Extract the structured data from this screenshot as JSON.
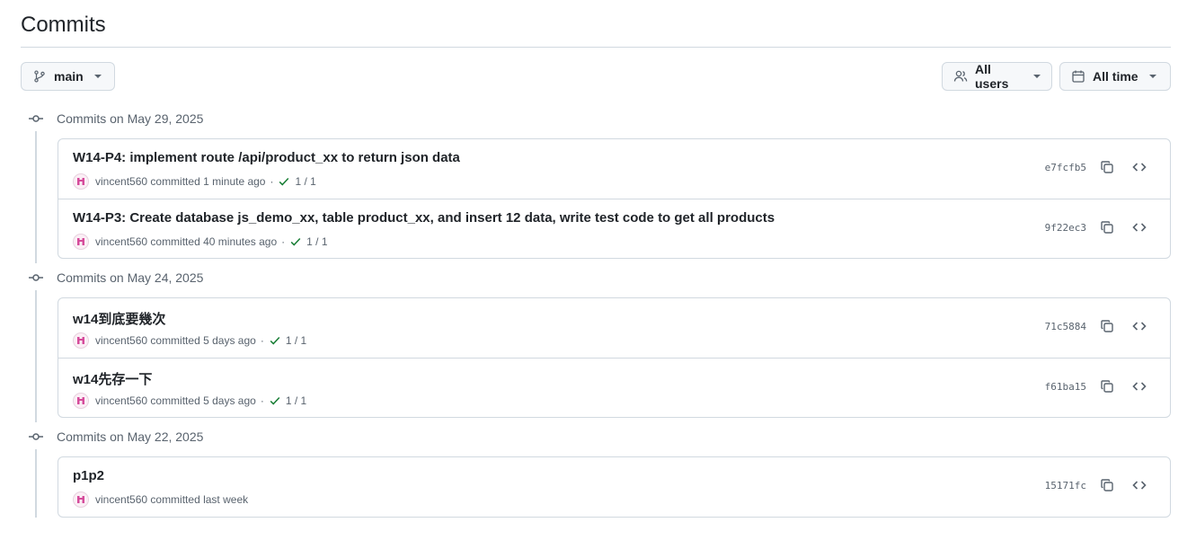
{
  "page": {
    "title": "Commits"
  },
  "filters": {
    "branch_label": "main",
    "users_label": "All users",
    "time_label": "All time"
  },
  "groups": [
    {
      "date": "Commits on May 29, 2025",
      "commits": [
        {
          "message": "W14-P4: implement route /api/product_xx to return json data",
          "author": "vincent560",
          "action": "committed",
          "time": "1 minute ago",
          "checks": "1 / 1",
          "sha": "e7fcfb5"
        },
        {
          "message": "W14-P3: Create database js_demo_xx, table product_xx, and insert 12 data, write test code to get all products",
          "author": "vincent560",
          "action": "committed",
          "time": "40 minutes ago",
          "checks": "1 / 1",
          "sha": "9f22ec3"
        }
      ]
    },
    {
      "date": "Commits on May 24, 2025",
      "commits": [
        {
          "message": "w14到底要幾次",
          "author": "vincent560",
          "action": "committed",
          "time": "5 days ago",
          "checks": "1 / 1",
          "sha": "71c5884"
        },
        {
          "message": "w14先存一下",
          "author": "vincent560",
          "action": "committed",
          "time": "5 days ago",
          "checks": "1 / 1",
          "sha": "f61ba15"
        }
      ]
    },
    {
      "date": "Commits on May 22, 2025",
      "commits": [
        {
          "message": "p1p2",
          "author": "vincent560",
          "action": "committed",
          "time": "last week",
          "sha": "15171fc"
        }
      ]
    }
  ],
  "colors": {
    "success": "#1a7f37",
    "muted": "#59636e",
    "border": "#d1d9e0"
  },
  "icons": {
    "branch": "git-branch-icon",
    "users": "people-icon",
    "time": "calendar-icon",
    "node": "git-commit-icon",
    "copy": "copy-icon",
    "browse": "code-icon",
    "check": "check-icon"
  }
}
